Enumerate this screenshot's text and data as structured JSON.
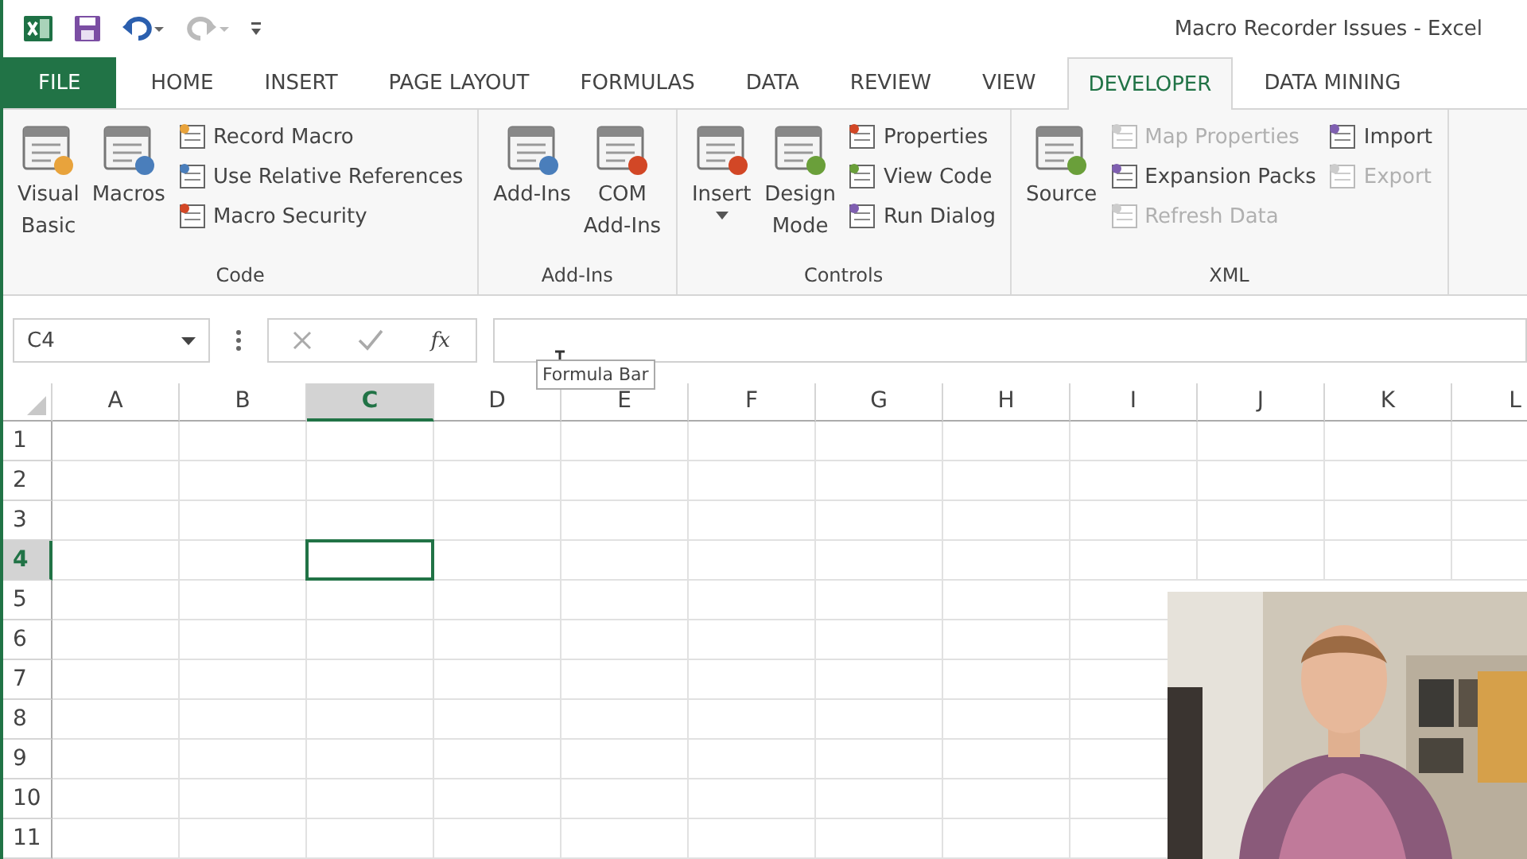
{
  "window": {
    "title": "Macro Recorder Issues - Excel"
  },
  "tabs": [
    {
      "label": "FILE",
      "kind": "file",
      "selected": false
    },
    {
      "label": "HOME",
      "kind": "tab",
      "selected": false
    },
    {
      "label": "INSERT",
      "kind": "tab",
      "selected": false
    },
    {
      "label": "PAGE LAYOUT",
      "kind": "tab",
      "selected": false
    },
    {
      "label": "FORMULAS",
      "kind": "tab",
      "selected": false
    },
    {
      "label": "DATA",
      "kind": "tab",
      "selected": false
    },
    {
      "label": "REVIEW",
      "kind": "tab",
      "selected": false
    },
    {
      "label": "VIEW",
      "kind": "tab",
      "selected": false
    },
    {
      "label": "DEVELOPER",
      "kind": "tab",
      "selected": true
    },
    {
      "label": "DATA MINING",
      "kind": "tab",
      "selected": false
    }
  ],
  "ribbon": {
    "groups": [
      {
        "label": "Code",
        "large": [
          {
            "lines": [
              "Visual",
              "Basic"
            ],
            "dropdown": false
          },
          {
            "lines": [
              "Macros"
            ],
            "dropdown": false
          }
        ],
        "small_columns": [
          [
            {
              "label": "Record Macro",
              "disabled": false
            },
            {
              "label": "Use Relative References",
              "disabled": false
            },
            {
              "label": "Macro Security",
              "disabled": false
            }
          ]
        ]
      },
      {
        "label": "Add-Ins",
        "large": [
          {
            "lines": [
              "Add-Ins"
            ],
            "dropdown": false
          },
          {
            "lines": [
              "COM",
              "Add-Ins"
            ],
            "dropdown": false
          }
        ]
      },
      {
        "label": "Controls",
        "large": [
          {
            "lines": [
              "Insert"
            ],
            "dropdown": true
          },
          {
            "lines": [
              "Design",
              "Mode"
            ],
            "dropdown": false
          }
        ],
        "small_columns": [
          [
            {
              "label": "Properties",
              "disabled": false
            },
            {
              "label": "View Code",
              "disabled": false
            },
            {
              "label": "Run Dialog",
              "disabled": false
            }
          ]
        ]
      },
      {
        "label": "XML",
        "large": [
          {
            "lines": [
              "Source"
            ],
            "dropdown": false
          }
        ],
        "small_columns": [
          [
            {
              "label": "Map Properties",
              "disabled": true
            },
            {
              "label": "Expansion Packs",
              "disabled": false
            },
            {
              "label": "Refresh Data",
              "disabled": true
            }
          ],
          [
            {
              "label": "Import",
              "disabled": false
            },
            {
              "label": "Export",
              "disabled": true
            }
          ]
        ]
      }
    ]
  },
  "formula_bar": {
    "name_box": "C4",
    "function_button": "fx",
    "tooltip": "Formula Bar"
  },
  "sheet": {
    "columns": [
      {
        "label": "A",
        "selected": false
      },
      {
        "label": "B",
        "selected": false
      },
      {
        "label": "C",
        "selected": true
      },
      {
        "label": "D",
        "selected": false
      },
      {
        "label": "E",
        "selected": false
      },
      {
        "label": "F",
        "selected": false
      },
      {
        "label": "G",
        "selected": false
      },
      {
        "label": "H",
        "selected": false
      },
      {
        "label": "I",
        "selected": false
      },
      {
        "label": "J",
        "selected": false
      },
      {
        "label": "K",
        "selected": false
      },
      {
        "label": "L",
        "selected": false
      }
    ],
    "rows": [
      {
        "label": "1",
        "selected": false
      },
      {
        "label": "2",
        "selected": false
      },
      {
        "label": "3",
        "selected": false
      },
      {
        "label": "4",
        "selected": true
      },
      {
        "label": "5",
        "selected": false
      },
      {
        "label": "6",
        "selected": false
      },
      {
        "label": "7",
        "selected": false
      },
      {
        "label": "8",
        "selected": false
      },
      {
        "label": "9",
        "selected": false
      },
      {
        "label": "10",
        "selected": false
      },
      {
        "label": "11",
        "selected": false
      }
    ]
  }
}
